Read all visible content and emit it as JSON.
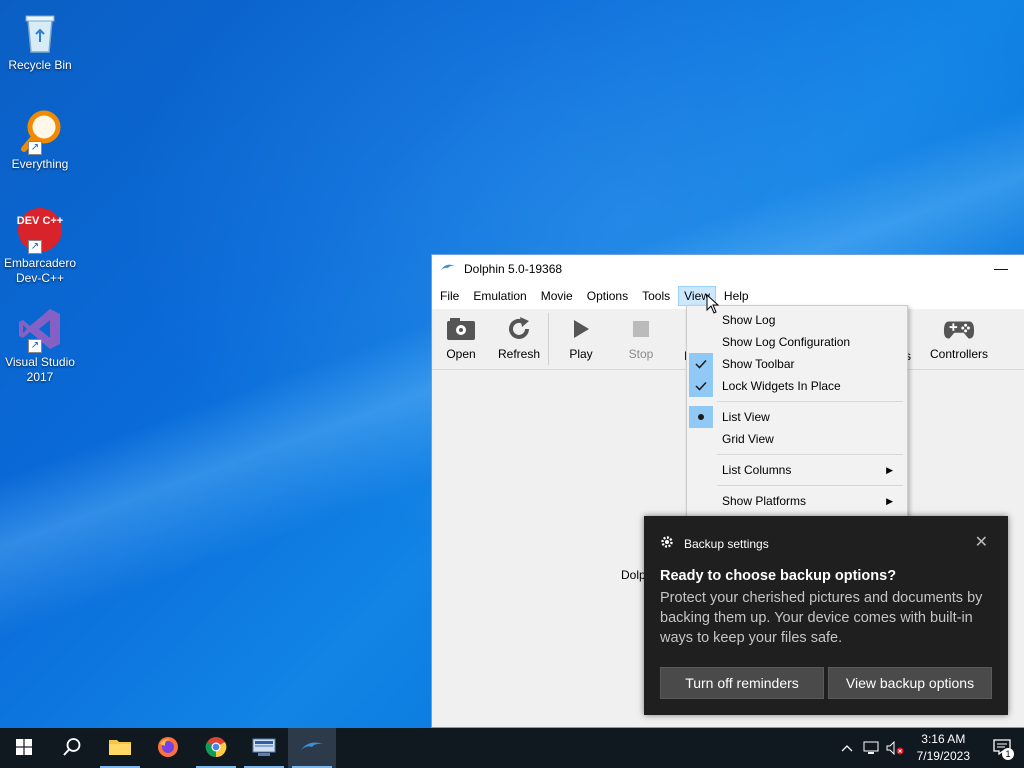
{
  "desktop": {
    "icons": [
      {
        "label": "Recycle Bin"
      },
      {
        "label": "Everything"
      },
      {
        "label": "Embarcadero Dev-C++",
        "badge_text": "DEV C++"
      },
      {
        "label": "Visual Studio 2017"
      }
    ]
  },
  "window": {
    "title": "Dolphin 5.0-19368",
    "minimize_glyph": "—",
    "menu": [
      "File",
      "Emulation",
      "Movie",
      "Options",
      "Tools",
      "View",
      "Help"
    ],
    "active_menu": "View",
    "toolbar": {
      "open": "Open",
      "refresh": "Refresh",
      "play": "Play",
      "stop": "Stop",
      "controllers": "Controllers",
      "partial_left": "I",
      "partial_right": "s"
    },
    "empty_text": "Dolp"
  },
  "view_menu": {
    "items": [
      {
        "label": "Show Log",
        "mark": ""
      },
      {
        "label": "Show Log Configuration",
        "mark": ""
      },
      {
        "label": "Show Toolbar",
        "mark": "check"
      },
      {
        "label": "Lock Widgets In Place",
        "mark": "check"
      },
      {
        "label": "List View",
        "mark": "radio"
      },
      {
        "label": "Grid View",
        "mark": ""
      },
      {
        "label": "List Columns",
        "submenu": true
      },
      {
        "label": "Show Platforms",
        "submenu": true
      }
    ]
  },
  "toast": {
    "app": "Backup settings",
    "title": "Ready to choose backup options?",
    "body": "Protect your cherished pictures and documents by backing them up. Your device comes with built-in ways to keep your files safe.",
    "button_left": "Turn off reminders",
    "button_right": "View backup options",
    "close_glyph": "✕"
  },
  "taskbar": {
    "time": "3:16 AM",
    "date": "7/19/2023",
    "notification_count": "1"
  },
  "colors": {
    "accent": "#0078d7",
    "menu_highlight": "#90c8f6",
    "toast_bg": "#1f1f1f",
    "taskbar_bg": "#101820"
  }
}
